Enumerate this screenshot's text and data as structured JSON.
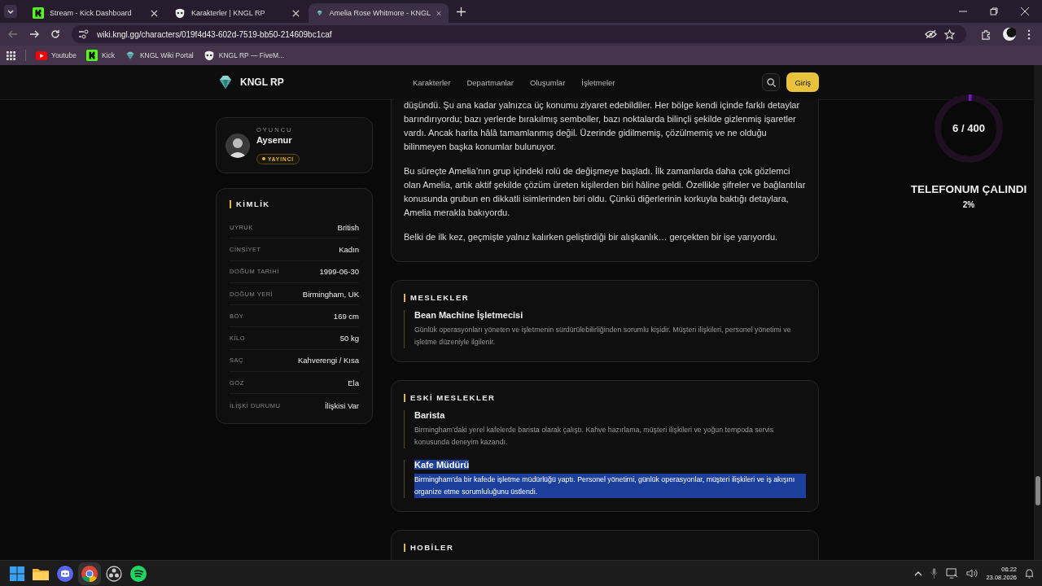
{
  "browser": {
    "tabs": [
      {
        "title": "Stream - Kick Dashboard",
        "kind": "kick",
        "selected": false
      },
      {
        "title": "Karakterler | KNGL RP",
        "kind": "mask",
        "selected": false
      },
      {
        "title": "Amelia Rose Whitmore - KNGL",
        "kind": "gem",
        "selected": true
      }
    ],
    "url": "wiki.kngl.gg/characters/019f4d43-602d-7519-bb50-214609bc1caf",
    "bookmarks": [
      {
        "label": "Youtube",
        "kind": "youtube"
      },
      {
        "label": "Kick",
        "kind": "kick"
      },
      {
        "label": "KNGL Wiki Portal",
        "kind": "gem"
      },
      {
        "label": "KNGL RP — FiveM...",
        "kind": "mask"
      }
    ]
  },
  "site": {
    "brand": "KNGL RP",
    "nav": [
      "Karakterler",
      "Departmanlar",
      "Oluşumlar",
      "İşletmeler"
    ],
    "login": "Giriş"
  },
  "player": {
    "label": "OYUNCU",
    "name": "Aysenur",
    "badge": "YAYINCI"
  },
  "identity": {
    "title": "KİMLİK",
    "fields": [
      {
        "label": "UYRUK",
        "value": "British"
      },
      {
        "label": "CİNSİYET",
        "value": "Kadın"
      },
      {
        "label": "DOĞUM TARİHİ",
        "value": "1999-06-30"
      },
      {
        "label": "DOĞUM YERİ",
        "value": "Birmingham, UK"
      },
      {
        "label": "BOY",
        "value": "169 cm"
      },
      {
        "label": "KİLO",
        "value": "50 kg"
      },
      {
        "label": "SAÇ",
        "value": "Kahverengi / Kısa"
      },
      {
        "label": "GÖZ",
        "value": "Ela"
      },
      {
        "label": "İLİŞKİ DURUMU",
        "value": "İlişkisi Var"
      }
    ]
  },
  "story": {
    "paragraphs": [
      "düşündü. Şu ana kadar yalnızca üç konumu ziyaret edebildiler. Her bölge kendi içinde farklı detaylar barındırıyordu; bazı yerlerde bırakılmış semboller, bazı noktalarda bilinçli şekilde gizlenmiş işaretler vardı. Ancak harita hâlâ tamamlanmış değil. Üzerinde gidilmemiş, çözülmemiş ve ne olduğu bilinmeyen başka konumlar bulunuyor.",
      "Bu süreçte Amelia’nın grup içindeki rolü de değişmeye başladı. İlk zamanlarda daha çok gözlemci olan Amelia, artık aktif şekilde çözüm üreten kişilerden biri hâline geldi. Özellikle şifreler ve bağlantılar konusunda grubun en dikkatli isimlerinden biri oldu. Çünkü diğerlerinin korkuyla baktığı detaylara, Amelia merakla bakıyordu.",
      "Belki de ilk kez, geçmişte yalnız kalırken geliştirdiği bir alışkanlık… gerçekten bir işe yarıyordu."
    ]
  },
  "sections": [
    {
      "title": "MESLEKLER",
      "jobs": [
        {
          "name": "Bean Machine İşletmecisi",
          "description": "Günlük operasyonları yöneten ve işletmenin sürdürülebilirliğinden sorumlu kişidir. Müşteri ilişkileri, personel yönetimi ve işletme düzeniyle ilgilenir.",
          "selected": false
        }
      ]
    },
    {
      "title": "ESKİ MESLEKLER",
      "jobs": [
        {
          "name": "Barista",
          "description": "Birmingham'daki yerel kafelerde barista olarak çalıştı. Kahve hazırlama, müşteri ilişkileri ve yoğun tempoda servis konusunda deneyim kazandı.",
          "selected": false
        },
        {
          "name": "Kafe Müdürü",
          "description": "Birmingham'da bir kafede işletme müdürlüğü yaptı. Personel yönetimi, günlük operasyonlar, müşteri ilişkileri ve iş akışını organize etme sorumluluğunu üstlendi.",
          "selected": true
        }
      ]
    },
    {
      "title": "HOBİLER"
    }
  ],
  "overlay": {
    "counter": "6 / 400",
    "level": 0.015,
    "title": "TELEFONUM ÇALINDI",
    "percent": "2%"
  },
  "taskbar": {
    "apps": [
      {
        "kind": "start"
      },
      {
        "kind": "folder"
      },
      {
        "kind": "discord"
      },
      {
        "kind": "chrome"
      },
      {
        "kind": "obs"
      },
      {
        "kind": "spotify"
      }
    ],
    "time": "06:22",
    "date": "23.08.2026"
  }
}
